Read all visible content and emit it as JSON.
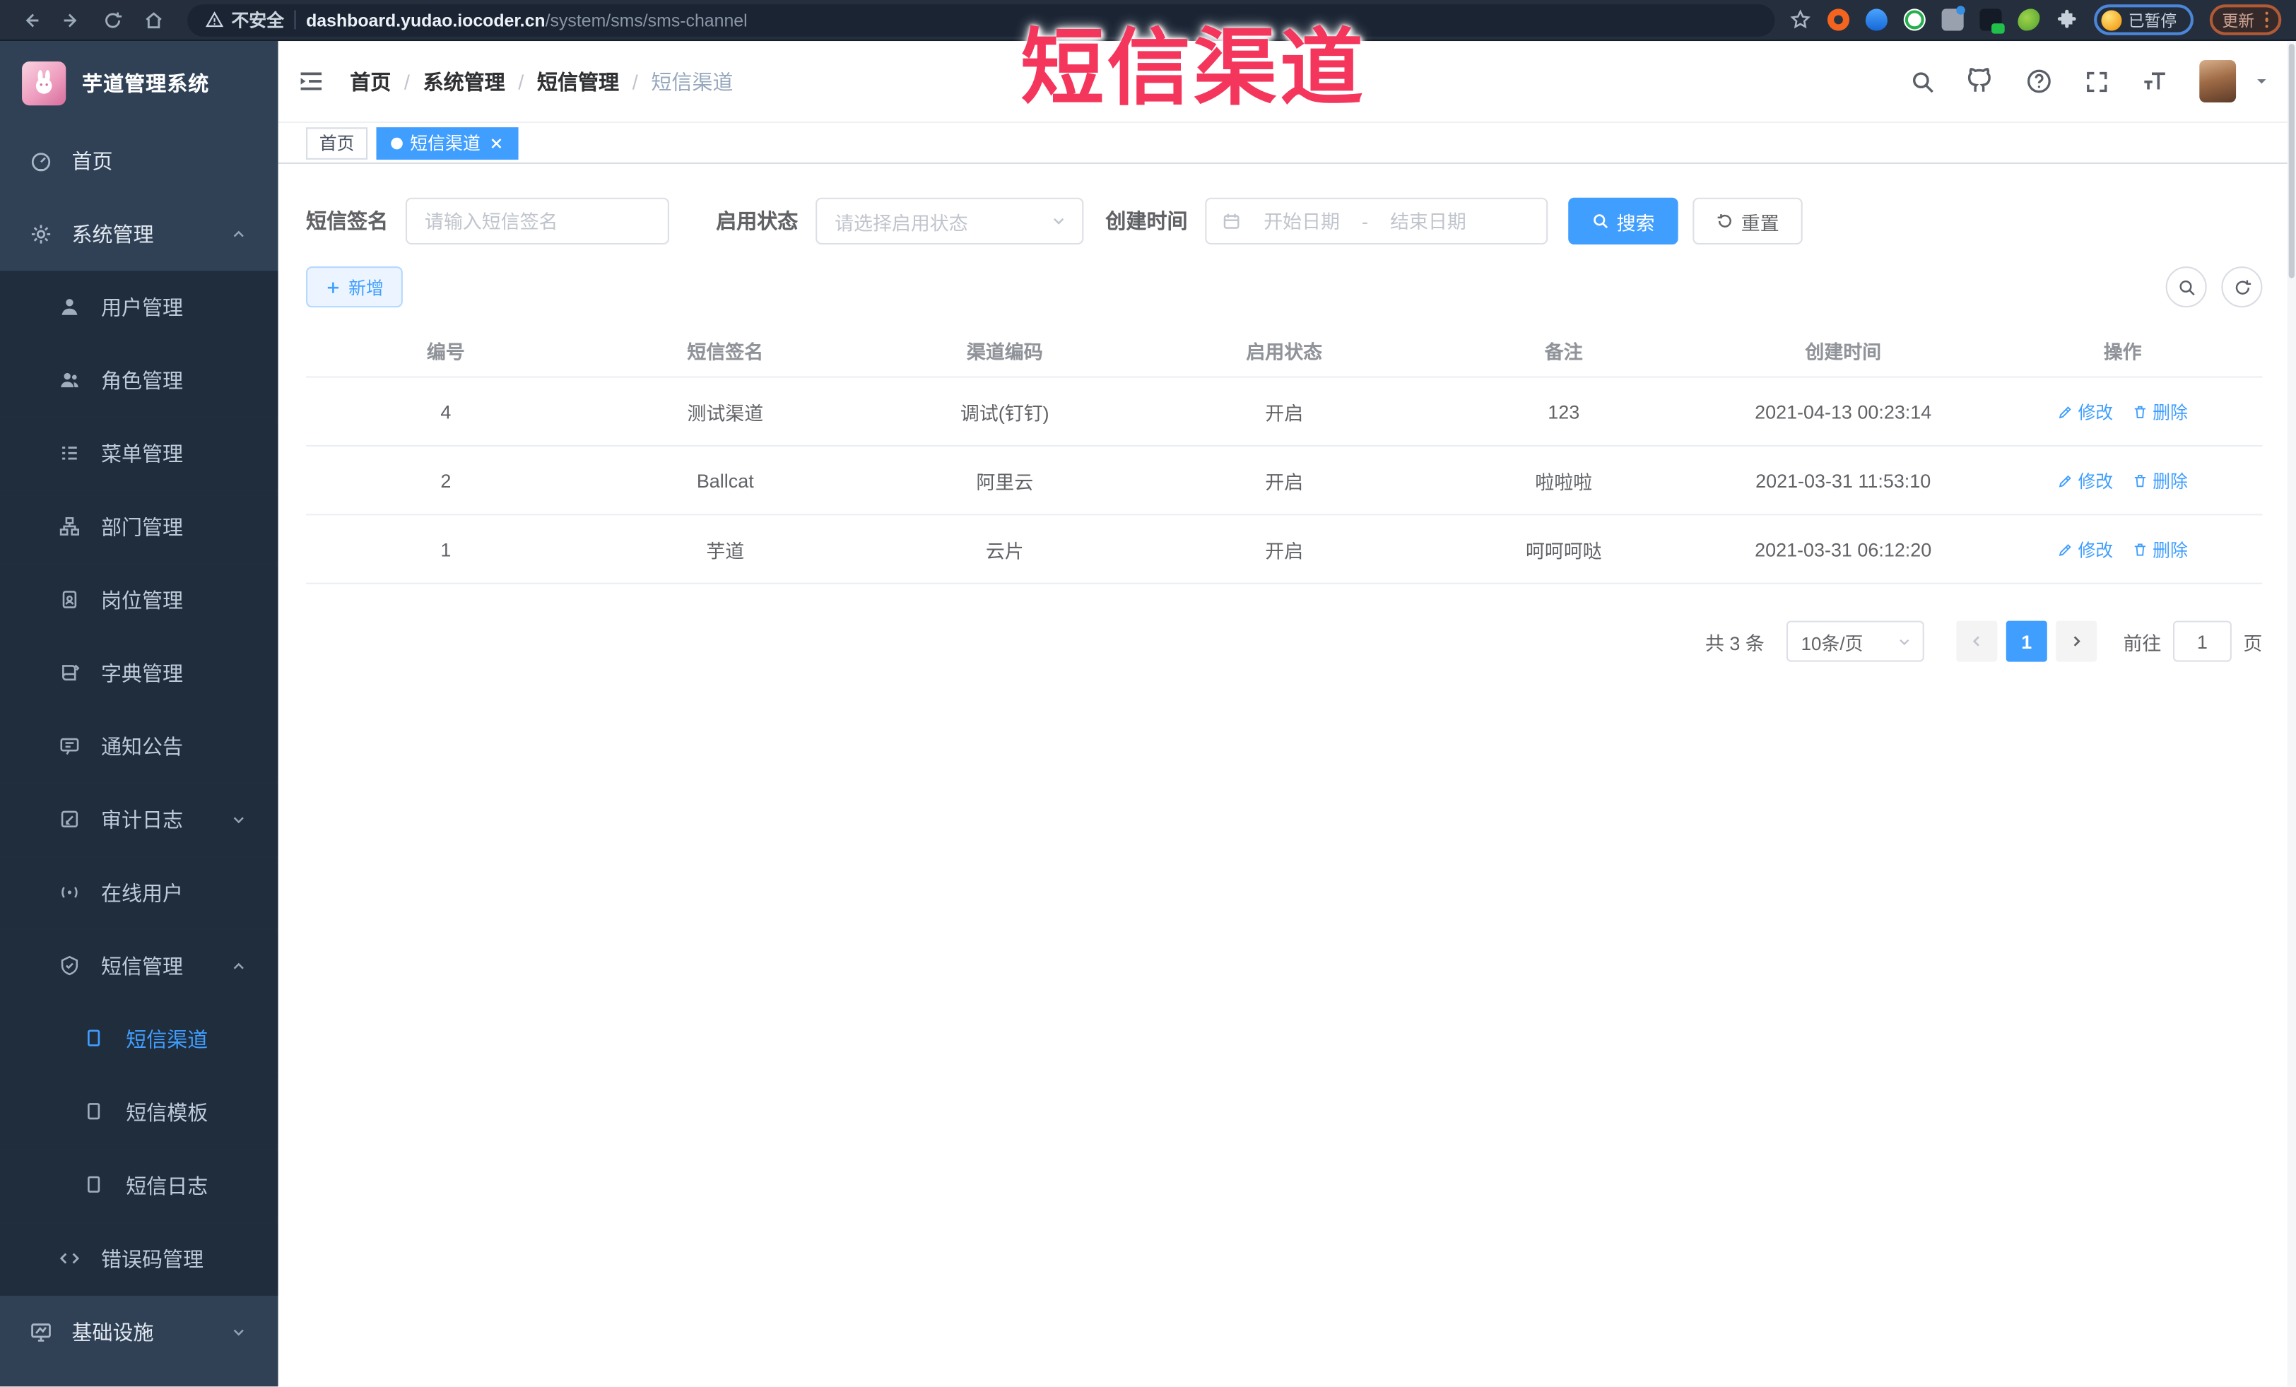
{
  "browser": {
    "security_label": "不安全",
    "url_host": "dashboard.yudao.iocoder.cn",
    "url_path": "/system/sms/sms-channel",
    "paused_label": "已暂停",
    "update_label": "更新"
  },
  "annotation": {
    "text": "短信渠道",
    "color": "#f5365c"
  },
  "sidebar": {
    "title": "芋道管理系统",
    "items": [
      {
        "label": "首页"
      },
      {
        "label": "系统管理"
      },
      {
        "label": "用户管理"
      },
      {
        "label": "角色管理"
      },
      {
        "label": "菜单管理"
      },
      {
        "label": "部门管理"
      },
      {
        "label": "岗位管理"
      },
      {
        "label": "字典管理"
      },
      {
        "label": "通知公告"
      },
      {
        "label": "审计日志"
      },
      {
        "label": "在线用户"
      },
      {
        "label": "短信管理"
      },
      {
        "label": "短信渠道"
      },
      {
        "label": "短信模板"
      },
      {
        "label": "短信日志"
      },
      {
        "label": "错误码管理"
      },
      {
        "label": "基础设施"
      }
    ]
  },
  "header": {
    "breadcrumb": [
      "首页",
      "系统管理",
      "短信管理",
      "短信渠道"
    ],
    "sep": "/"
  },
  "tags": {
    "home": "首页",
    "active": "短信渠道"
  },
  "filters": {
    "sign_label": "短信签名",
    "sign_placeholder": "请输入短信签名",
    "status_label": "启用状态",
    "status_placeholder": "请选择启用状态",
    "time_label": "创建时间",
    "start_placeholder": "开始日期",
    "range_sep": "-",
    "end_placeholder": "结束日期",
    "search_label": "搜索",
    "reset_label": "重置"
  },
  "toolbar": {
    "add_label": "新增"
  },
  "table": {
    "columns": [
      "编号",
      "短信签名",
      "渠道编码",
      "启用状态",
      "备注",
      "创建时间",
      "操作"
    ],
    "rows": [
      {
        "id": "4",
        "sign": "测试渠道",
        "code": "调试(钉钉)",
        "status": "开启",
        "remark": "123",
        "time": "2021-04-13 00:23:14"
      },
      {
        "id": "2",
        "sign": "Ballcat",
        "code": "阿里云",
        "status": "开启",
        "remark": "啦啦啦",
        "time": "2021-03-31 11:53:10"
      },
      {
        "id": "1",
        "sign": "芋道",
        "code": "云片",
        "status": "开启",
        "remark": "呵呵呵哒",
        "time": "2021-03-31 06:12:20"
      }
    ],
    "edit_label": "修改",
    "delete_label": "删除"
  },
  "pagination": {
    "total": "共 3 条",
    "page_size": "10条/页",
    "current": "1",
    "goto_label": "前往",
    "goto_value": "1",
    "page_unit": "页"
  },
  "colors": {
    "primary": "#409EFF",
    "sidebar_bg": "#304156",
    "submenu_bg": "#1f2d3d",
    "annotation": "#f5365c"
  }
}
